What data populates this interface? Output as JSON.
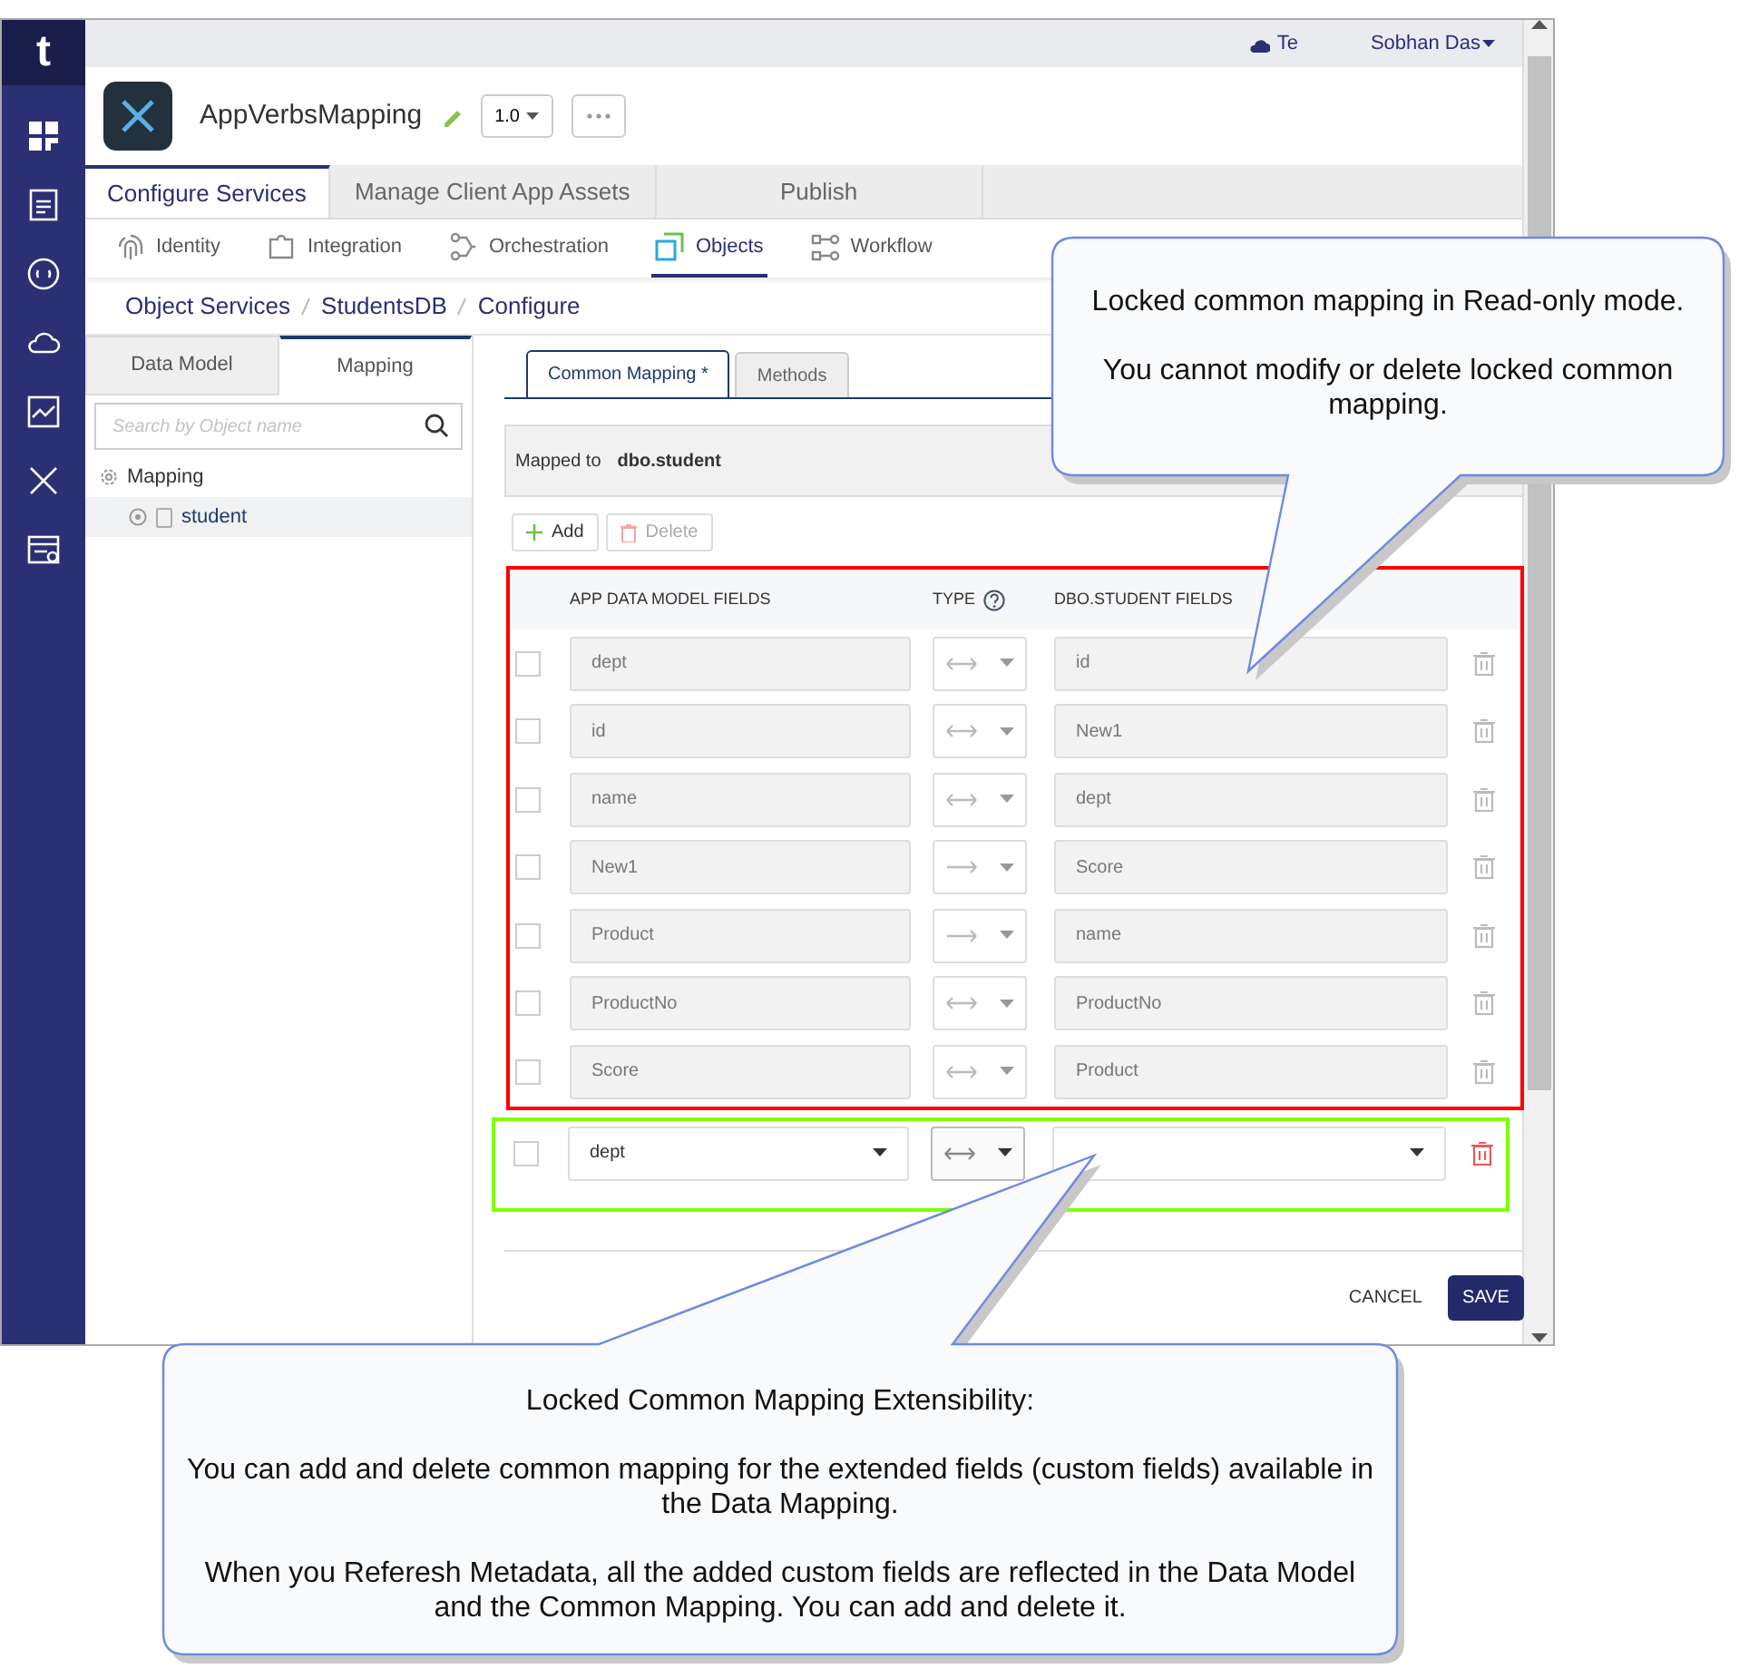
{
  "logo": "t",
  "topbar": {
    "tenant": "Te",
    "user": "Sobhan Das"
  },
  "app": {
    "name": "AppVerbsMapping",
    "version": "1.0"
  },
  "main_tabs": [
    {
      "label": "Configure Services",
      "selected": true
    },
    {
      "label": "Manage Client App Assets",
      "selected": false
    },
    {
      "label": "Publish",
      "selected": false
    }
  ],
  "service_tabs": [
    {
      "label": "Identity",
      "kind": "identity",
      "selected": false
    },
    {
      "label": "Integration",
      "kind": "integration",
      "selected": false
    },
    {
      "label": "Orchestration",
      "kind": "orchestration",
      "selected": false
    },
    {
      "label": "Objects",
      "kind": "objects",
      "selected": true
    },
    {
      "label": "Workflow",
      "kind": "workflow",
      "selected": false
    }
  ],
  "breadcrumb": [
    "Object Services",
    "StudentsDB",
    "Configure"
  ],
  "left_panel": {
    "tabs": [
      {
        "label": "Data Model",
        "selected": false
      },
      {
        "label": "Mapping",
        "selected": true
      }
    ],
    "search": {
      "placeholder": "Search by Object name"
    },
    "tree": [
      {
        "label": "Mapping",
        "selected": false,
        "children": [
          {
            "label": "student",
            "selected": true
          }
        ]
      }
    ]
  },
  "mapping_tabs": [
    {
      "label": "Common Mapping *",
      "selected": true
    },
    {
      "label": "Methods",
      "selected": false
    }
  ],
  "mapped_to": {
    "label": "Mapped to",
    "value": "dbo.student"
  },
  "actions": [
    {
      "label": "Add",
      "kind": "add",
      "disabled": false
    },
    {
      "label": "Delete",
      "kind": "delete",
      "disabled": true
    }
  ],
  "columns": [
    "APP DATA MODEL FIELDS",
    "TYPE",
    "DBO.STUDENT FIELDS"
  ],
  "rows": [
    {
      "source": "dept",
      "kind": "both",
      "target": "id",
      "locked": true,
      "checked": false
    },
    {
      "source": "id",
      "kind": "both",
      "target": "New1",
      "locked": true,
      "checked": false
    },
    {
      "source": "name",
      "kind": "both",
      "target": "dept",
      "locked": true,
      "checked": false
    },
    {
      "source": "New1",
      "kind": "right",
      "target": "Score",
      "locked": true,
      "checked": false
    },
    {
      "source": "Product",
      "kind": "right",
      "target": "name",
      "locked": true,
      "checked": false
    },
    {
      "source": "ProductNo",
      "kind": "both",
      "target": "ProductNo",
      "locked": true,
      "checked": false
    },
    {
      "source": "Score",
      "kind": "both",
      "target": "Product",
      "locked": true,
      "checked": false
    },
    {
      "source": "dept",
      "kind": "both",
      "locked": false,
      "checked": false
    }
  ],
  "highlights": [
    {
      "color": "#ff0000"
    },
    {
      "color": "#80ff00"
    }
  ],
  "footer_buttons": [
    {
      "label": "CANCEL",
      "kind": "link"
    },
    {
      "label": "SAVE",
      "kind": "primary"
    }
  ],
  "callouts": [
    {
      "paragraphs": [
        "Locked common mapping in Read-only mode.",
        "You cannot modify or delete locked common mapping."
      ]
    },
    {
      "paragraphs": [
        "Locked Common Mapping Extensibility:",
        "You can add and delete common mapping for the extended fields (custom fields) available in the Data Mapping.",
        "When you Referesh Metadata, all the added custom fields are reflected in the Data Model and the Common Mapping. You can add and delete it."
      ]
    }
  ]
}
